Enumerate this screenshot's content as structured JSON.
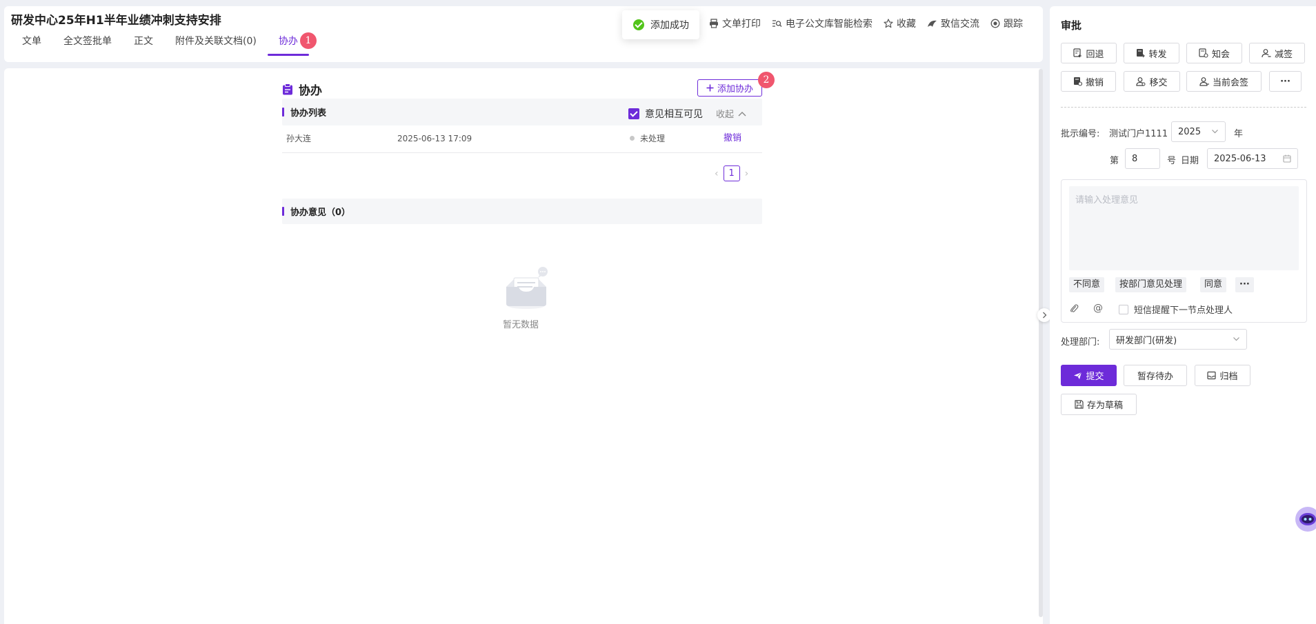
{
  "header": {
    "title": "研发中心25年H1半年业绩冲刺支持安排",
    "tabs": [
      {
        "label": "文单"
      },
      {
        "label": "全文签批单"
      },
      {
        "label": "正文"
      },
      {
        "label": "附件及关联文档(0)"
      },
      {
        "label": "协办",
        "active": true,
        "badge": "1"
      }
    ],
    "toast": "添加成功",
    "toolbar": [
      {
        "label": "文单打印",
        "icon": "printer-icon"
      },
      {
        "label": "电子公文库智能检索",
        "icon": "search-list-icon"
      },
      {
        "label": "收藏",
        "icon": "star-icon"
      },
      {
        "label": "致信交流",
        "icon": "chat-bird-icon"
      },
      {
        "label": "跟踪",
        "icon": "target-icon"
      }
    ]
  },
  "xieban": {
    "title": "协办",
    "add_label": "添加协办",
    "add_badge": "2",
    "list_title": "协办列表",
    "visible_label": "意见相互可见",
    "collapse_label": "收起",
    "rows": [
      {
        "name": "孙大连",
        "time": "2025-06-13 17:09",
        "status": "未处理",
        "action": "撤销"
      }
    ],
    "page": "1",
    "opinion_title": "协办意见（0）",
    "empty_text": "暂无数据"
  },
  "approval": {
    "title": "审批",
    "actions_row1": [
      {
        "label": "回退",
        "icon": "return-doc-icon"
      },
      {
        "label": "转发",
        "icon": "forward-doc-icon"
      },
      {
        "label": "知会",
        "icon": "notify-doc-icon"
      },
      {
        "label": "减签",
        "icon": "remove-signer-icon"
      }
    ],
    "actions_row2": [
      {
        "label": "撤销",
        "icon": "revoke-doc-icon"
      },
      {
        "label": "移交",
        "icon": "transfer-user-icon"
      },
      {
        "label": "当前会签",
        "icon": "countersign-icon"
      }
    ],
    "more": "···",
    "serial_label": "批示编号:",
    "serial_prefix": "测试门户1111",
    "year_value": "2025",
    "year_suffix": "年",
    "no_prefix": "第",
    "no_value": "8",
    "no_suffix": "号",
    "date_label": "日期",
    "date_value": "2025-06-13",
    "opinion_placeholder": "请输入处理意见",
    "quick": [
      "不同意",
      "按部门意见处理",
      "同意"
    ],
    "quick_more": "···",
    "sms_label": "短信提醒下一节点处理人",
    "dept_label": "处理部门:",
    "dept_value": "研发部门(研发)",
    "submit": "提交",
    "save_todo": "暂存待办",
    "archive": "归档",
    "save_draft": "存为草稿"
  },
  "colors": {
    "accent": "#6d2bd9",
    "badge": "#f0566e",
    "success": "#52c41a"
  }
}
